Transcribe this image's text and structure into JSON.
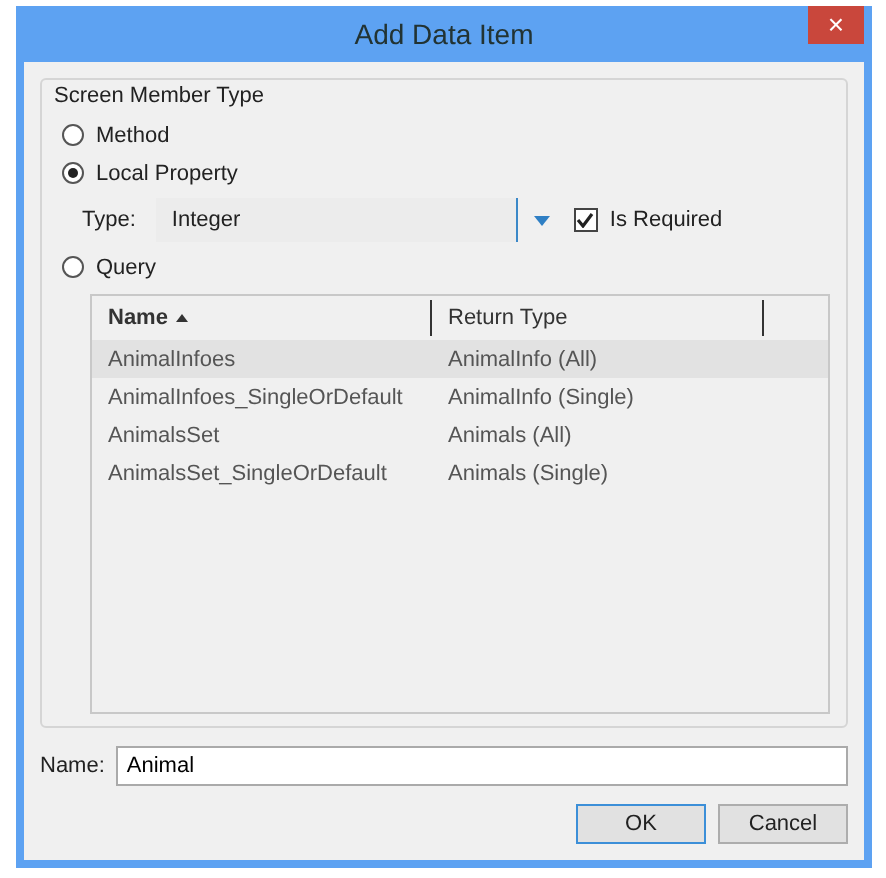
{
  "window": {
    "title": "Add Data Item",
    "close": "×"
  },
  "group": {
    "title": "Screen Member Type",
    "options": [
      {
        "label": "Method",
        "selected": false
      },
      {
        "label": "Local Property",
        "selected": true
      },
      {
        "label": "Query",
        "selected": false
      }
    ]
  },
  "type_row": {
    "label": "Type:",
    "value": "Integer",
    "is_required": {
      "label": "Is Required",
      "checked": true
    }
  },
  "table": {
    "columns": [
      {
        "label": "Name",
        "sorted": true
      },
      {
        "label": "Return Type",
        "sorted": false
      }
    ],
    "rows": [
      {
        "name": "AnimalInfoes",
        "return_type": "AnimalInfo (All)",
        "selected": true
      },
      {
        "name": "AnimalInfoes_SingleOrDefault",
        "return_type": "AnimalInfo (Single)",
        "selected": false
      },
      {
        "name": "AnimalsSet",
        "return_type": "Animals (All)",
        "selected": false
      },
      {
        "name": "AnimalsSet_SingleOrDefault",
        "return_type": "Animals (Single)",
        "selected": false
      }
    ]
  },
  "name_field": {
    "label": "Name:",
    "value": "Animal"
  },
  "buttons": [
    {
      "label": "OK",
      "default": true
    },
    {
      "label": "Cancel",
      "default": false
    }
  ]
}
